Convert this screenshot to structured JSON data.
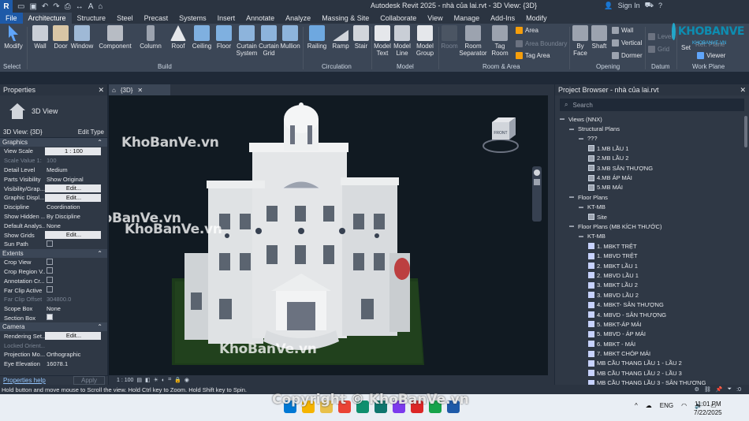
{
  "app": {
    "logo_letter": "R",
    "title": "Autodesk Revit 2025 - nhà của lai.rvt - 3D View: {3D}",
    "sign_in": "Sign In",
    "help": "?"
  },
  "tabs": [
    "File",
    "Architecture",
    "Structure",
    "Steel",
    "Precast",
    "Systems",
    "Insert",
    "Annotate",
    "Analyze",
    "Massing & Site",
    "Collaborate",
    "View",
    "Manage",
    "Add-Ins",
    "Modify"
  ],
  "active_tab": "Architecture",
  "ribbon": {
    "modify": "Modify",
    "select": "Select",
    "build": {
      "label": "Build",
      "buttons": [
        "Wall",
        "Door",
        "Window",
        "Component",
        "Column",
        "Roof",
        "Ceiling",
        "Floor",
        "Curtain System",
        "Curtain Grid",
        "Mullion"
      ]
    },
    "circulation": {
      "label": "Circulation",
      "buttons": [
        "Railing",
        "Ramp",
        "Stair"
      ]
    },
    "model": {
      "label": "Model",
      "buttons": [
        "Model Text",
        "Model Line",
        "Model Group"
      ]
    },
    "room_area": {
      "label": "Room & Area",
      "buttons": [
        "Room",
        "Room Separator",
        "Tag Room"
      ],
      "small": [
        "Area",
        "Area Boundary",
        "Tag Area"
      ]
    },
    "opening": {
      "label": "Opening",
      "buttons": [
        "By Face",
        "Shaft"
      ],
      "small": [
        "Wall",
        "Vertical",
        "Dormer"
      ]
    },
    "datum": {
      "label": "Datum",
      "small": [
        "Level",
        "Grid"
      ]
    },
    "work_plane": {
      "label": "Work Plane",
      "set": "Set",
      "small": [
        "Ref. Plane",
        "Viewer"
      ]
    }
  },
  "logo": {
    "text": "KHOBANVE",
    "sub": "KHOBANVE.VN"
  },
  "properties": {
    "title": "Properties",
    "type_name": "3D View",
    "instance": "3D View: {3D}",
    "edit_type": "Edit Type",
    "apply": "Apply",
    "help": "Properties help",
    "sections": [
      {
        "name": "Graphics",
        "rows": [
          {
            "name": "View Scale",
            "value": "1 : 100",
            "kind": "box"
          },
          {
            "name": "Scale Value  1:",
            "value": "100",
            "kind": "dim"
          },
          {
            "name": "Detail Level",
            "value": "Medium",
            "kind": "text"
          },
          {
            "name": "Parts Visibility",
            "value": "Show Original",
            "kind": "text"
          },
          {
            "name": "Visibility/Grap...",
            "value": "Edit...",
            "kind": "box"
          },
          {
            "name": "Graphic Displ...",
            "value": "Edit...",
            "kind": "box"
          },
          {
            "name": "Discipline",
            "value": "Coordination",
            "kind": "text"
          },
          {
            "name": "Show Hidden ...",
            "value": "By Discipline",
            "kind": "text"
          },
          {
            "name": "Default Analys...",
            "value": "None",
            "kind": "text"
          },
          {
            "name": "Show Grids",
            "value": "Edit...",
            "kind": "box"
          },
          {
            "name": "Sun Path",
            "value": "",
            "kind": "check"
          }
        ]
      },
      {
        "name": "Extents",
        "rows": [
          {
            "name": "Crop View",
            "value": "",
            "kind": "check"
          },
          {
            "name": "Crop Region V...",
            "value": "",
            "kind": "check"
          },
          {
            "name": "Annotation Cr...",
            "value": "",
            "kind": "check"
          },
          {
            "name": "Far Clip Active",
            "value": "",
            "kind": "check"
          },
          {
            "name": "Far Clip Offset",
            "value": "304800.0",
            "kind": "dim"
          },
          {
            "name": "Scope Box",
            "value": "None",
            "kind": "text"
          },
          {
            "name": "Section Box",
            "value": "",
            "kind": "checkon"
          }
        ]
      },
      {
        "name": "Camera",
        "rows": [
          {
            "name": "Rendering Set...",
            "value": "Edit...",
            "kind": "box"
          },
          {
            "name": "Locked Orient...",
            "value": "",
            "kind": "dim"
          },
          {
            "name": "Projection Mo...",
            "value": "Orthographic",
            "kind": "text"
          },
          {
            "name": "Eye Elevation",
            "value": "16078.1",
            "kind": "text"
          }
        ]
      }
    ]
  },
  "view": {
    "tab": "{3D}",
    "scale": "1 : 100",
    "viewcube_face": "FRONT",
    "main_model": "Main Model",
    "watermarks": [
      "KhoBanVe.vn",
      "KhoBanVe.vn",
      "KhoBanVe.vn",
      "KhoBanVe.vn"
    ]
  },
  "browser": {
    "title": "Project Browser - nhà của lai.rvt",
    "search_placeholder": "Search",
    "tree": [
      {
        "label": "Views (NNX)",
        "level": 0,
        "kind": "root"
      },
      {
        "label": "Structural Plans",
        "level": 1,
        "kind": "group"
      },
      {
        "label": "???",
        "level": 2,
        "kind": "group"
      },
      {
        "label": "1.MB LẦU 1",
        "level": 3,
        "kind": "sheet"
      },
      {
        "label": "2.MB LẦU 2",
        "level": 3,
        "kind": "sheet"
      },
      {
        "label": "3.MB SÂN THƯỢNG",
        "level": 3,
        "kind": "sheet"
      },
      {
        "label": "4.MB ÁP MÁI",
        "level": 3,
        "kind": "sheet"
      },
      {
        "label": "5.MB MÁI",
        "level": 3,
        "kind": "sheet"
      },
      {
        "label": "Floor Plans",
        "level": 1,
        "kind": "group"
      },
      {
        "label": "KT-MB",
        "level": 2,
        "kind": "group"
      },
      {
        "label": "Site",
        "level": 3,
        "kind": "sheet"
      },
      {
        "label": "Floor Plans (MB KÍCH THƯỚC)",
        "level": 1,
        "kind": "group"
      },
      {
        "label": "KT-MB",
        "level": 2,
        "kind": "group"
      },
      {
        "label": "1. MBKT TRỆT",
        "level": 3,
        "kind": "plan"
      },
      {
        "label": "1. MBVD TRỆT",
        "level": 3,
        "kind": "plan"
      },
      {
        "label": "2. MBKT LẦU 1",
        "level": 3,
        "kind": "plan"
      },
      {
        "label": "2. MBVD LẦU 1",
        "level": 3,
        "kind": "plan"
      },
      {
        "label": "3. MBKT LẦU 2",
        "level": 3,
        "kind": "plan"
      },
      {
        "label": "3. MBVD LẦU 2",
        "level": 3,
        "kind": "plan"
      },
      {
        "label": "4. MBKT- SÂN THƯỢNG",
        "level": 3,
        "kind": "plan"
      },
      {
        "label": "4. MBVD - SÂN THƯỢNG",
        "level": 3,
        "kind": "plan"
      },
      {
        "label": "5. MBKT-ÁP MÁI",
        "level": 3,
        "kind": "plan"
      },
      {
        "label": "5. MBVD - ÁP MÁI",
        "level": 3,
        "kind": "plan"
      },
      {
        "label": "6. MBKT - MÁI",
        "level": 3,
        "kind": "plan"
      },
      {
        "label": "7. MBKT CHÓP MÁI",
        "level": 3,
        "kind": "plan"
      },
      {
        "label": "MB CẦU THANG LẦU 1 - LẦU 2",
        "level": 3,
        "kind": "plan"
      },
      {
        "label": "MB CẦU THANG LẦU 2 - LẦU 3",
        "level": 3,
        "kind": "plan"
      },
      {
        "label": "MB CẦU THANG LẦU 3 - SÂN THƯỢNG",
        "level": 3,
        "kind": "plan"
      }
    ],
    "footer_count": ":0"
  },
  "status": {
    "hint": "Hold button and move mouse to Scroll the view. Hold Ctrl key to Zoom. Hold Shift key to Spin.",
    "count": ":0"
  },
  "taskbar": {
    "lang": "ENG",
    "time": "11:01 PM",
    "date": "7/22/2025",
    "copyright": "Copyright © KhoBanVe.vn"
  },
  "colors": {
    "accent": "#1e5aa8",
    "panel": "#2f3845",
    "ribbon": "#3b4656"
  }
}
